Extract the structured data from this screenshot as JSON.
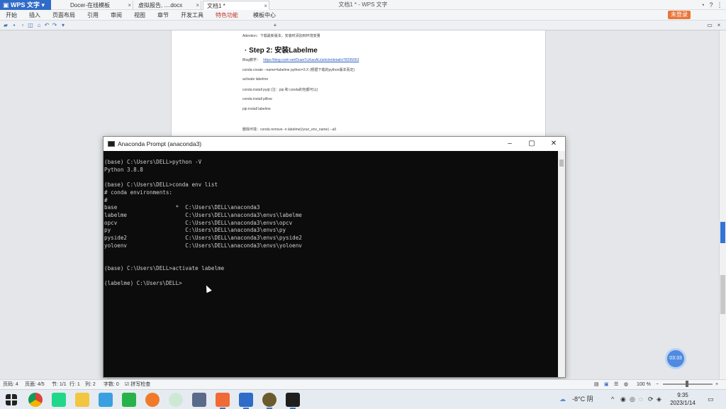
{
  "app": {
    "name": "WPS 文字",
    "window_title": "文档1 * - WPS 文字"
  },
  "menubar": [
    "开始",
    "插入",
    "页面布局",
    "引用",
    "审阅",
    "视图",
    "章节",
    "开发工具",
    "特色功能",
    "模板中心"
  ],
  "login_label": "未登录",
  "tabs": [
    {
      "label": "Docer-在线模板"
    },
    {
      "label": "虚拟报告, ....docx"
    },
    {
      "label": "文档1 *"
    }
  ],
  "document": {
    "attention": "Attention：下载最新版本，安装时添加到环境变量",
    "step_title": "Step 2:   安装Labelme",
    "blog_label": "Blog教学：",
    "blog_link": "https://blog.csdn.net/DuanTuXiaoALi/article/details/78295053",
    "lines": [
      "conda create --name=labelme python=3.X (根据下载的python版本而定)",
      "activate labelme",
      "conda install pyqt          (注：pip 和 conda的包都可以)",
      "conda install pillow",
      "pip install labelme"
    ],
    "delete_env": "删除环境：conda remove -n labelme(/your_env_name) --all"
  },
  "cmd": {
    "title": "Anaconda Prompt (anaconda3)",
    "lines": [
      "(base) C:\\Users\\DELL>python -V",
      "Python 3.8.8",
      "",
      "(base) C:\\Users\\DELL>conda env list",
      "# conda environments:",
      "#",
      "base                  *  C:\\Users\\DELL\\anaconda3",
      "labelme                  C:\\Users\\DELL\\anaconda3\\envs\\labelme",
      "opcv                     C:\\Users\\DELL\\anaconda3\\envs\\opcv",
      "py                       C:\\Users\\DELL\\anaconda3\\envs\\py",
      "pyside2                  C:\\Users\\DELL\\anaconda3\\envs\\pyside2",
      "yoloenv                  C:\\Users\\DELL\\anaconda3\\envs\\yoloenv",
      "",
      "",
      "(base) C:\\Users\\DELL>activate labelme",
      "",
      "(labelme) C:\\Users\\DELL>"
    ]
  },
  "floating_badge": "03:33",
  "statusbar": {
    "page_code": "页码: 4",
    "pages": "页面: 4/5",
    "section": "节: 1/1",
    "row": "行: 1",
    "col": "列: 2",
    "word_count": "字数: 0",
    "spell": "拼写检查",
    "zoom": "100 %"
  },
  "tray": {
    "temperature": "-8°C 阴",
    "time": "9:35",
    "date": "2023/1/14"
  },
  "colors": {
    "wps_blue": "#2f6bc8",
    "login_orange": "#e8763a",
    "console_bg": "#0c0c0c",
    "console_text": "#cfcfcf"
  }
}
